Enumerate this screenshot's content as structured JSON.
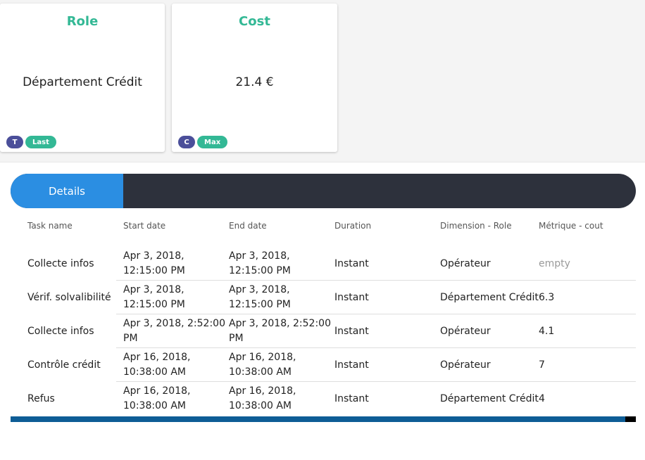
{
  "cards": [
    {
      "title": "Role",
      "value": "Département Crédit",
      "badge_letter": "T",
      "badge_label": "Last"
    },
    {
      "title": "Cost",
      "value": "21.4 €",
      "badge_letter": "C",
      "badge_label": "Max"
    }
  ],
  "tabs": {
    "active": "Details"
  },
  "table": {
    "headers": [
      "Task name",
      "Start date",
      "End date",
      "Duration",
      "Dimension - Role",
      "Métrique - cout"
    ],
    "rows": [
      [
        "Collecte infos",
        "Apr 3, 2018, 12:15:00 PM",
        "Apr 3, 2018, 12:15:00 PM",
        "Instant",
        "Opérateur",
        "empty"
      ],
      [
        "Vérif. solvalibilité",
        "Apr 3, 2018, 12:15:00 PM",
        "Apr 3, 2018, 12:15:00 PM",
        "Instant",
        "Département Crédit",
        "6.3"
      ],
      [
        "Collecte infos",
        "Apr 3, 2018, 2:52:00 PM",
        "Apr 3, 2018, 2:52:00 PM",
        "Instant",
        "Opérateur",
        "4.1"
      ],
      [
        "Contrôle crédit",
        "Apr 16, 2018, 10:38:00 AM",
        "Apr 16, 2018, 10:38:00 AM",
        "Instant",
        "Opérateur",
        "7"
      ],
      [
        "Refus",
        "Apr 16, 2018, 10:38:00 AM",
        "Apr 16, 2018, 10:38:00 AM",
        "Instant",
        "Département Crédit",
        "4"
      ]
    ]
  },
  "colors": {
    "accent_green": "#33b895",
    "badge_purple": "#4b4f9a",
    "tab_blue": "#2b8ee2",
    "tabbar_dark": "#2d313c",
    "scrollbar_blue": "#0e5d96"
  }
}
